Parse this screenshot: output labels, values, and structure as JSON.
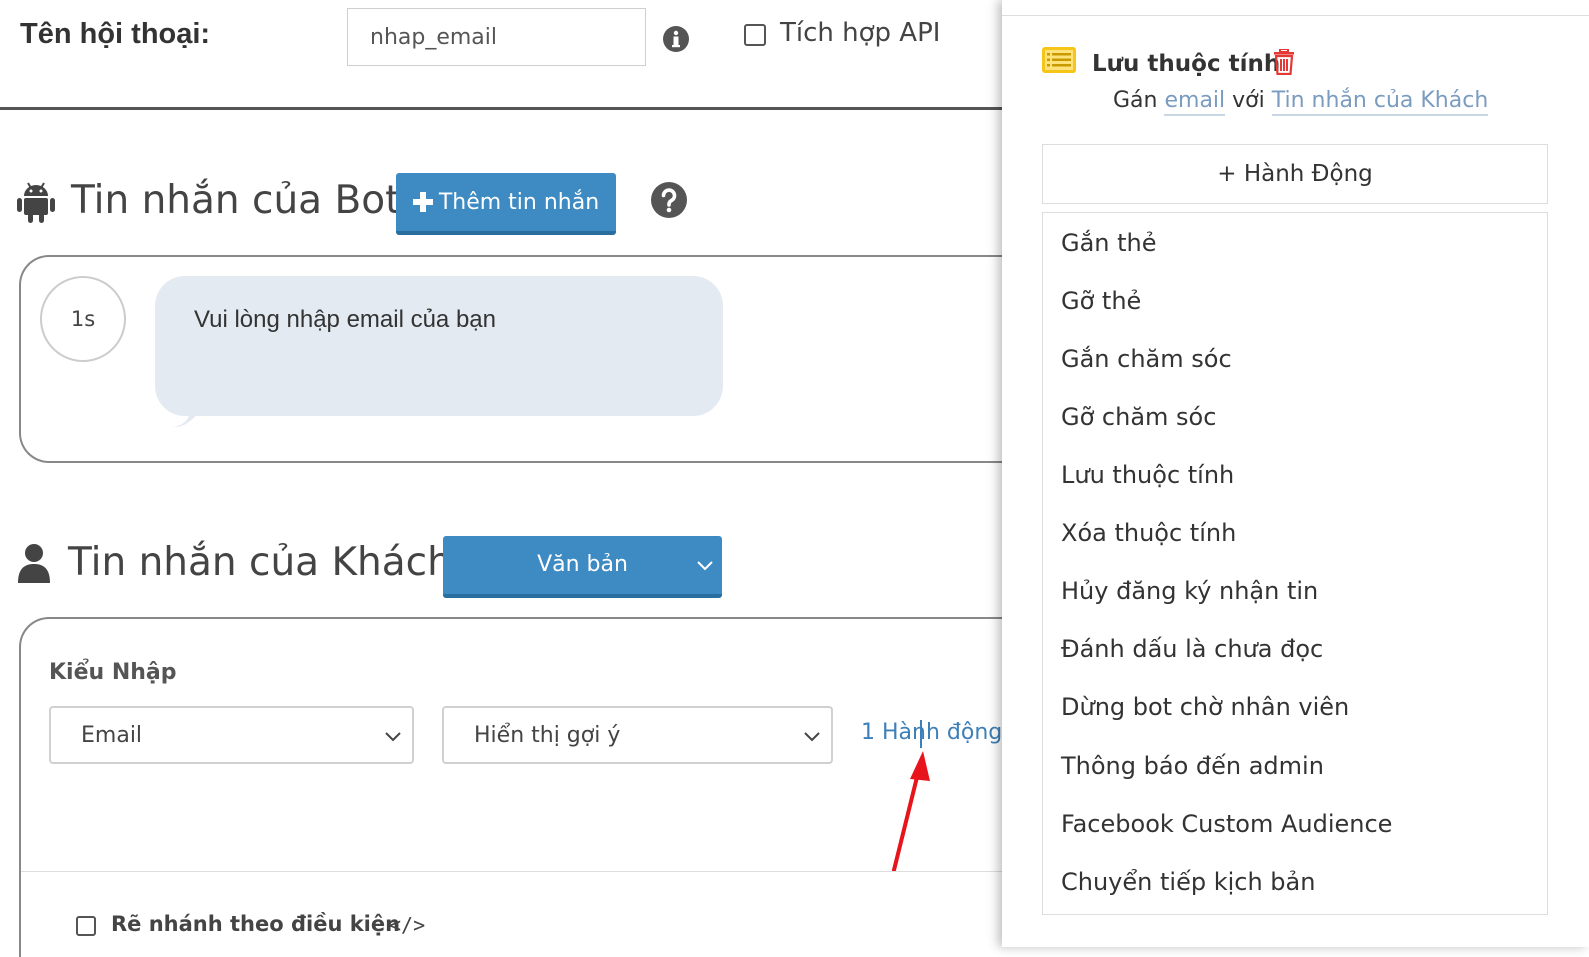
{
  "header": {
    "conversation_label": "Tên hội thoại:",
    "conversation_name": "nhap_email",
    "api_label": "Tích hợp API",
    "api_checked": false
  },
  "bot_section": {
    "title": "Tin nhắn của Bot",
    "add_message_label": "Thêm tin nhắn",
    "delay": "1s",
    "message": "Vui lòng nhập email của bạn"
  },
  "customer_section": {
    "title": "Tin nhắn của Khách",
    "type_button_label": "Văn bản",
    "input_type_label": "Kiểu Nhập",
    "input_type_value": "Email",
    "suggestion_value": "Hiển thị gợi ý",
    "actions_link": "1 Hành động",
    "branch_label": "Rẽ nhánh theo điều kiện",
    "branch_checked": false,
    "code_symbol": "</>"
  },
  "panel": {
    "attr_title": "Lưu thuộc tính",
    "assign_prefix": "Gán",
    "assign_attr": "email",
    "assign_mid": "với",
    "assign_source": "Tin nhắn của Khách",
    "add_action_label": "+ Hành Động",
    "menu_items": [
      "Gắn thẻ",
      "Gỡ thẻ",
      "Gắn chăm sóc",
      "Gỡ chăm sóc",
      "Lưu thuộc tính",
      "Xóa thuộc tính",
      "Hủy đăng ký nhận tin",
      "Đánh dấu là chưa đọc",
      "Dừng bot chờ nhân viên",
      "Thông báo đến admin",
      "Facebook Custom Audience",
      "Chuyển tiếp kịch bản"
    ]
  },
  "colors": {
    "primary_button": "#3d8bc2",
    "link": "#3d7fb8",
    "bubble": "#e3eaf2",
    "trash": "#e53935",
    "attr_icon": "#f5c518",
    "arrow": "#e8141b"
  },
  "icons": [
    "info-icon",
    "android-icon",
    "help-icon",
    "user-icon",
    "chevron-down-icon",
    "list-icon",
    "trash-icon",
    "code-icon"
  ]
}
